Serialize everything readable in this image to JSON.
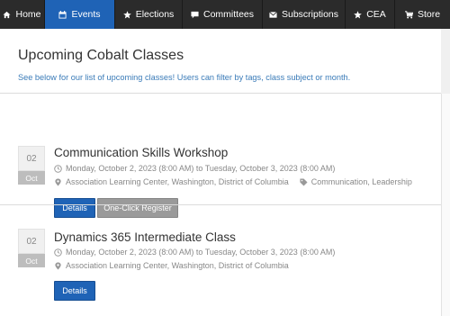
{
  "nav": {
    "items": [
      {
        "label": "Home",
        "icon": "home-icon"
      },
      {
        "label": "Events",
        "icon": "calendar-icon",
        "active": true
      },
      {
        "label": "Elections",
        "icon": "star-icon"
      },
      {
        "label": "Committees",
        "icon": "chat-icon"
      },
      {
        "label": "Subscriptions",
        "icon": "envelope-icon"
      },
      {
        "label": "CEA",
        "icon": "star-icon"
      },
      {
        "label": "Store",
        "icon": "cart-icon"
      }
    ],
    "active_color": "#1f63b6",
    "bar_color": "#2b2b2b"
  },
  "page": {
    "title": "Upcoming Cobalt Classes",
    "description": "See below for our list of upcoming classes! Users can filter by tags, class subject or month."
  },
  "events": [
    {
      "day": "02",
      "month": "Oct",
      "title": "Communication Skills Workshop",
      "datetime": "Monday, October 2, 2023 (8:00 AM) to Tuesday, October 3, 2023 (8:00 AM)",
      "location": "Association Learning Center, Washington, District of Columbia",
      "tags": "Communication, Leadership",
      "details_label": "Details",
      "register_label": "One-Click Register"
    },
    {
      "day": "02",
      "month": "Oct",
      "title": "Dynamics 365 Intermediate Class",
      "datetime": "Monday, October 2, 2023 (8:00 AM) to Tuesday, October 3, 2023 (8:00 AM)",
      "location": "Association Learning Center, Washington, District of Columbia",
      "details_label": "Details"
    }
  ]
}
